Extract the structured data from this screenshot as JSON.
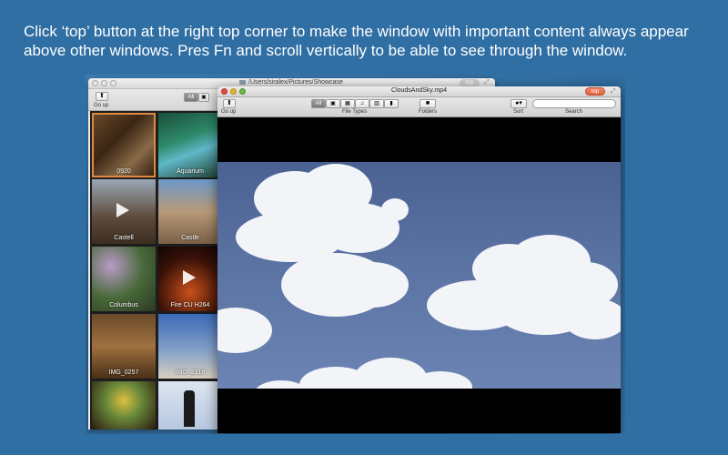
{
  "caption": "Click ‘top’ button at the right top corner to make the window with important content always appear above other windows. Pres Fn and scroll vertically to be able to see through the window.",
  "back_window": {
    "path": "/Users/siralex/Pictures/Showcase",
    "top_button": "top",
    "go_up_label": "Go up",
    "filter_all": "All",
    "thumbnails": [
      {
        "label": "0920",
        "selected": true
      },
      {
        "label": "Aquarium"
      },
      {
        "label": "Castell",
        "video": true
      },
      {
        "label": "Castle"
      },
      {
        "label": "Columbus"
      },
      {
        "label": "Fire CU H264",
        "video": true
      },
      {
        "label": "IMG_0257"
      },
      {
        "label": "IMG_2318"
      },
      {
        "label": ""
      },
      {
        "label": ""
      }
    ]
  },
  "front_window": {
    "title": "CloudsAndSky.mp4",
    "top_button": "top",
    "go_up_label": "Go up",
    "filter_all": "All",
    "file_types_label": "File Types",
    "folders_label": "Folders",
    "sort_label": "Sort",
    "search_label": "Search"
  },
  "colors": {
    "desktop": "#2f6fa3",
    "top_button_active": "#e0603c",
    "sky": "#5b73a3"
  },
  "icons": [
    "up-arrow-icon",
    "image-icon",
    "film-icon",
    "music-icon",
    "book-icon",
    "document-icon",
    "folder-icon",
    "sort-icon",
    "search-icon",
    "play-icon",
    "resize-icon"
  ]
}
